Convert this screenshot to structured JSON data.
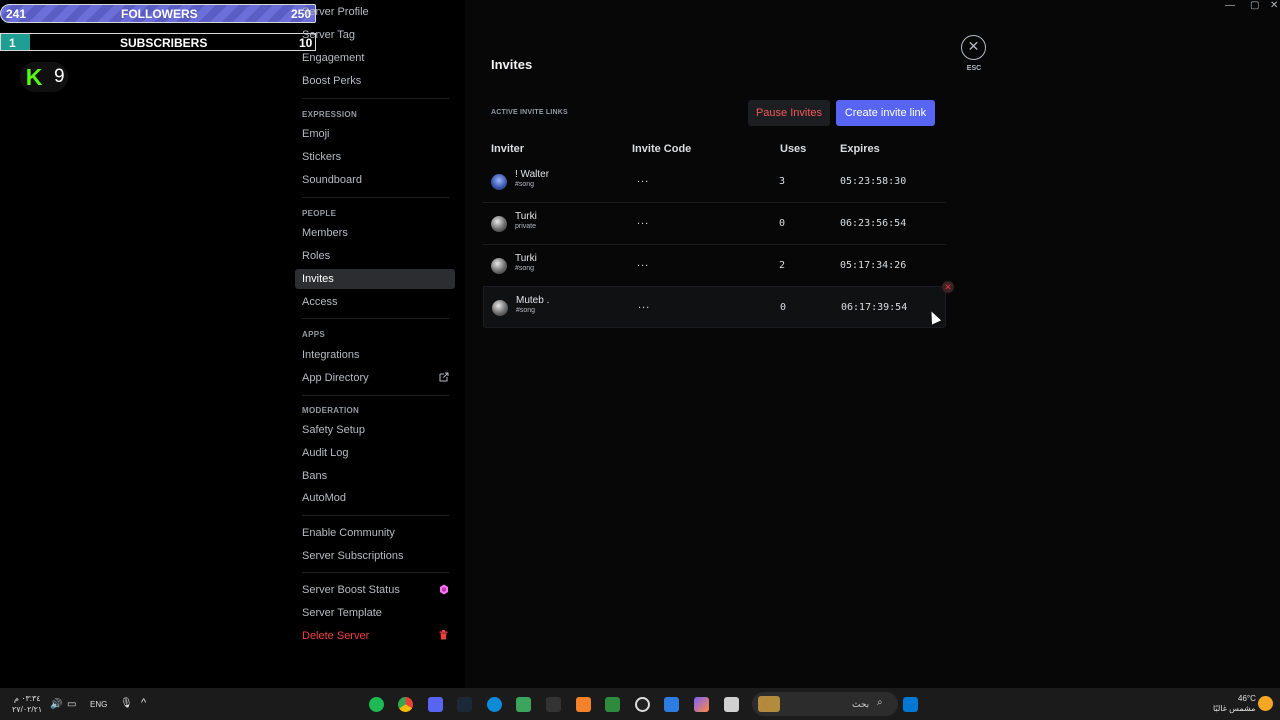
{
  "overlay": {
    "followers": {
      "current": "241",
      "label": "FOLLOWERS",
      "goal": "250"
    },
    "subscribers": {
      "current": "1",
      "label": "SUBSCRIBERS",
      "goal": "10"
    },
    "kick": {
      "logo": "K",
      "count": "9"
    }
  },
  "sidebar": {
    "top_items": [
      "Server Profile",
      "Server Tag",
      "Engagement",
      "Boost Perks"
    ],
    "expression": {
      "heading": "EXPRESSION",
      "items": [
        "Emoji",
        "Stickers",
        "Soundboard"
      ]
    },
    "people": {
      "heading": "PEOPLE",
      "items": [
        "Members",
        "Roles",
        "Invites",
        "Access"
      ]
    },
    "apps": {
      "heading": "APPS",
      "items": [
        "Integrations",
        "App Directory"
      ]
    },
    "moderation": {
      "heading": "MODERATION",
      "items": [
        "Safety Setup",
        "Audit Log",
        "Bans",
        "AutoMod"
      ]
    },
    "extra": [
      "Enable Community",
      "Server Subscriptions"
    ],
    "boost": [
      "Server Boost Status",
      "Server Template"
    ],
    "delete": "Delete Server",
    "active": "Invites"
  },
  "invites": {
    "title": "Invites",
    "esc": "ESC",
    "section_label": "ACTIVE INVITE LINKS",
    "pause_label": "Pause Invites",
    "create_label": "Create invite link",
    "columns": [
      "Inviter",
      "Invite Code",
      "Uses",
      "Expires"
    ],
    "rows": [
      {
        "inviter": "! Walter",
        "channel": "#song",
        "code": "...",
        "uses": "3",
        "expires": "05:23:58:30"
      },
      {
        "inviter": "Turki",
        "channel": "private",
        "code": "...",
        "uses": "0",
        "expires": "06:23:56:54"
      },
      {
        "inviter": "Turki",
        "channel": "#song",
        "code": "...",
        "uses": "2",
        "expires": "05:17:34:26"
      },
      {
        "inviter": "Muteb .",
        "channel": "#song",
        "code": "...",
        "uses": "0",
        "expires": "06:17:39:54"
      }
    ]
  },
  "taskbar": {
    "clock_time": "٠٣:٣٤ م",
    "clock_date": "٢٧/٠٢/٢١",
    "lang": "ENG",
    "search_placeholder": "بحث",
    "weather_temp": "46°C",
    "weather_desc": "مشمس غالبًا"
  },
  "colors": {
    "accent": "#5865f2",
    "danger": "#f23f43",
    "kick": "#53fc18"
  }
}
